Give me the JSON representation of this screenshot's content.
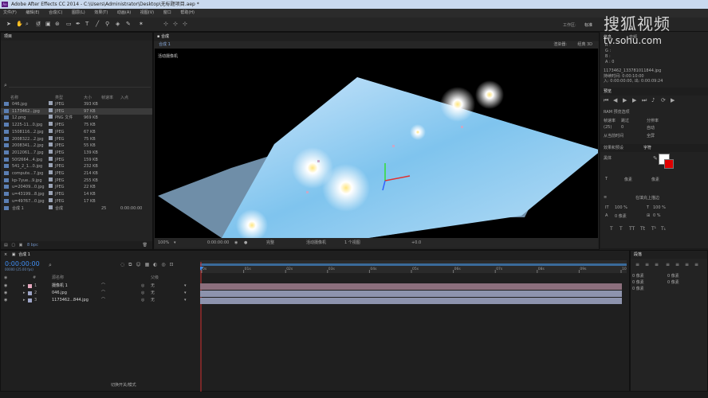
{
  "title_bar": {
    "app_badge": "Ae",
    "title": "Adobe After Effects CC 2014 - C:\\Users\\Administrator\\Desktop\\无标题项目.aep *"
  },
  "menu": [
    "文件(F)",
    "编辑(E)",
    "合成(C)",
    "图层(L)",
    "效果(T)",
    "动画(A)",
    "视图(V)",
    "窗口",
    "帮助(H)"
  ],
  "toolbar": {
    "workspace_label": "工作区:",
    "workspace_value": "标准"
  },
  "project": {
    "tab": "项目",
    "search_icon": "search-icon",
    "columns": {
      "name": "名称",
      "type": "类型",
      "size": "大小",
      "fps": "帧速率",
      "in": "入点"
    },
    "files": [
      {
        "name": "046.jpg",
        "type": "JPEG",
        "size": "393 KB"
      },
      {
        "name": "1173462...jpg",
        "type": "JPEG",
        "size": "97 KB"
      },
      {
        "name": "12.png",
        "type": "PNG 文件",
        "size": "969 KB"
      },
      {
        "name": "1225-11...0.jpg",
        "type": "JPEG",
        "size": "75 KB"
      },
      {
        "name": "1508116...2.jpg",
        "type": "JPEG",
        "size": "67 KB"
      },
      {
        "name": "2008322...2.jpg",
        "type": "JPEG",
        "size": "75 KB"
      },
      {
        "name": "2008341...2.jpg",
        "type": "JPEG",
        "size": "55 KB"
      },
      {
        "name": "2012061...7.jpg",
        "type": "JPEG",
        "size": "139 KB"
      },
      {
        "name": "50f2664...4.jpg",
        "type": "JPEG",
        "size": "159 KB"
      },
      {
        "name": "541_2_1...0.jpg",
        "type": "JPEG",
        "size": "232 KB"
      },
      {
        "name": "compute...7.jpg",
        "type": "JPEG",
        "size": "214 KB"
      },
      {
        "name": "kp-7yue...9.jpg",
        "type": "JPEG",
        "size": "255 KB"
      },
      {
        "name": "u=20409...0.jpg",
        "type": "JPEG",
        "size": "22 KB"
      },
      {
        "name": "u=43199...8.jpg",
        "type": "JPEG",
        "size": "14 KB"
      },
      {
        "name": "u=49767...0.jpg",
        "type": "JPEG",
        "size": "17 KB"
      },
      {
        "name": "合成 1",
        "type": "合成",
        "size": "",
        "fps": "25",
        "in": "0:00:00:00"
      }
    ],
    "footer_bpc": "8 bpc"
  },
  "comp_viewer": {
    "tab": "合成",
    "comp_name": "合成 1",
    "renderer_label": "渲染器:",
    "renderer_value": "经典 3D",
    "camera_label": "活动摄像机",
    "zoom": "100%",
    "timecode": "0:00:00:00",
    "quality": "完整",
    "view": "活动摄像机",
    "views": "1 个视图",
    "offset": "+0.0"
  },
  "info_panel": {
    "tabs": [
      "信息",
      "音频"
    ],
    "r": "R :",
    "g": "G :",
    "b": "B :",
    "a": "A : 0",
    "file": "1173462_133781011844.jpg",
    "duration": "持续时间: 0:00:10:00",
    "range": "入: 0:00:00:00, 出: 0:00:09:24"
  },
  "preview": {
    "tab": "预览",
    "ram_options": "RAM 预览选项",
    "fps_label": "帧速率",
    "skip_label": "跳过",
    "res_label": "分辨率",
    "fps": "(25)",
    "skip": "0",
    "res": "自动",
    "from_current": "从当前时间",
    "fullscreen": "全屏"
  },
  "effects_panel": {
    "tab": "效果和预设",
    "char_tab": "字符"
  },
  "character": {
    "font": "黑体",
    "size_label": "像素",
    "tracking": "在填充上描边",
    "scale_v": "100 %",
    "scale_h": "100 %",
    "baseline": "0 像素",
    "tsume": "0 %",
    "line1": "像素",
    "line2": "像素"
  },
  "paragraph": {
    "tab": "段落",
    "lines": [
      "0 像素",
      "0 像素",
      "0 像素",
      "0 像素",
      "0 像素"
    ]
  },
  "timeline": {
    "tab": "合成 1",
    "timecode": "0:00:00:00",
    "timecode_sub": "00000 (25.00 fps)",
    "cols": {
      "num": "#",
      "name": "源名称",
      "parent": "父级"
    },
    "layers": [
      {
        "num": "1",
        "name": "摄像机 1",
        "parent": "无",
        "color": "#e7a8bf"
      },
      {
        "num": "2",
        "name": "046.jpg",
        "parent": "无",
        "color": "#9fa6c8"
      },
      {
        "num": "3",
        "name": "1173462...844.jpg",
        "parent": "无",
        "color": "#9fa6c8"
      }
    ],
    "ruler": [
      "0s",
      "01s",
      "02s",
      "03s",
      "04s",
      "05s",
      "06s",
      "07s",
      "08s",
      "09s",
      "10s"
    ],
    "footer": "切换开关/模式"
  },
  "watermark": {
    "line1": "搜狐视频",
    "line2": "tv.sohu.com"
  }
}
